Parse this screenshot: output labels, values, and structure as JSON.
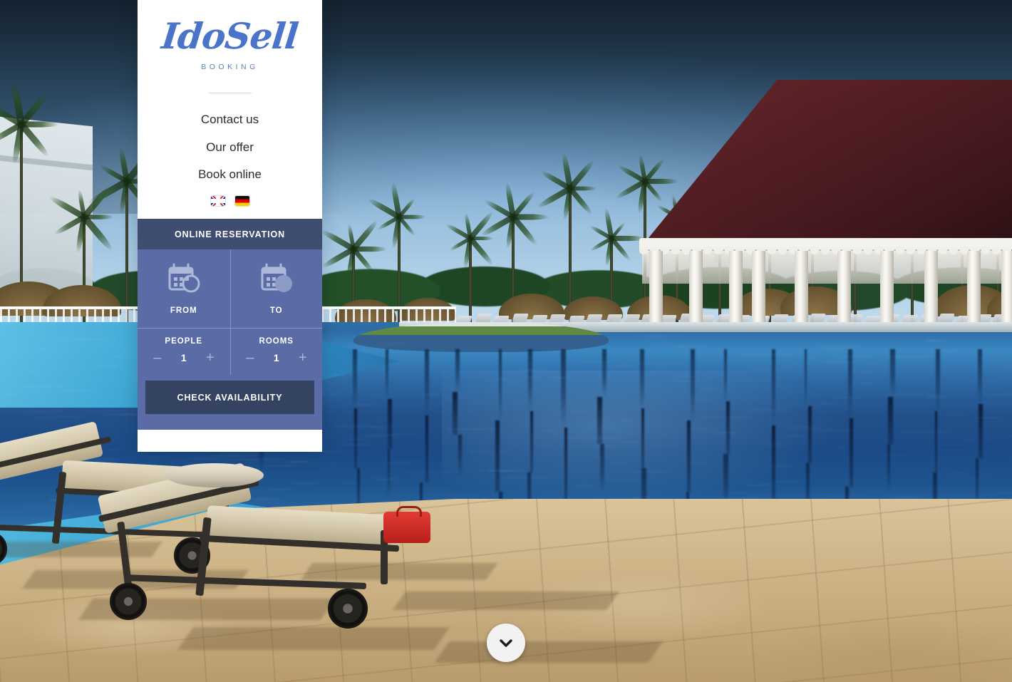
{
  "site": {
    "logo_text": "IdoSell",
    "logo_subtitle": "BOOKING"
  },
  "nav": {
    "items": [
      {
        "label": "Contact us",
        "name": "nav-contact-us"
      },
      {
        "label": "Our offer",
        "name": "nav-our-offer"
      },
      {
        "label": "Book online",
        "name": "nav-book-online"
      }
    ]
  },
  "languages": [
    {
      "code": "en",
      "name": "flag-uk-icon",
      "title": "English"
    },
    {
      "code": "de",
      "name": "flag-de-icon",
      "title": "Deutsch"
    }
  ],
  "reservation": {
    "title": "ONLINE RESERVATION",
    "from": {
      "label": "FROM",
      "icon": "calendar-from-icon",
      "value": ""
    },
    "to": {
      "label": "TO",
      "icon": "calendar-to-icon",
      "value": ""
    },
    "people": {
      "label": "PEOPLE",
      "value": "1",
      "minus": "–",
      "plus": "+"
    },
    "rooms": {
      "label": "ROOMS",
      "value": "1",
      "minus": "–",
      "plus": "+"
    },
    "submit_label": "CHECK AVAILABILITY"
  },
  "hero": {
    "scroll_icon": "chevron-down-icon",
    "image_description": "Resort swimming pool with palm trees, thatched gazebo bar and sun loungers"
  },
  "colors": {
    "panel_header": "#3f4d71",
    "panel_body": "#5a6ba5",
    "cta": "#354363",
    "logo": "#4a74c9",
    "nav_text": "#2a2c31",
    "stepper_control": "#a9b5d8"
  }
}
